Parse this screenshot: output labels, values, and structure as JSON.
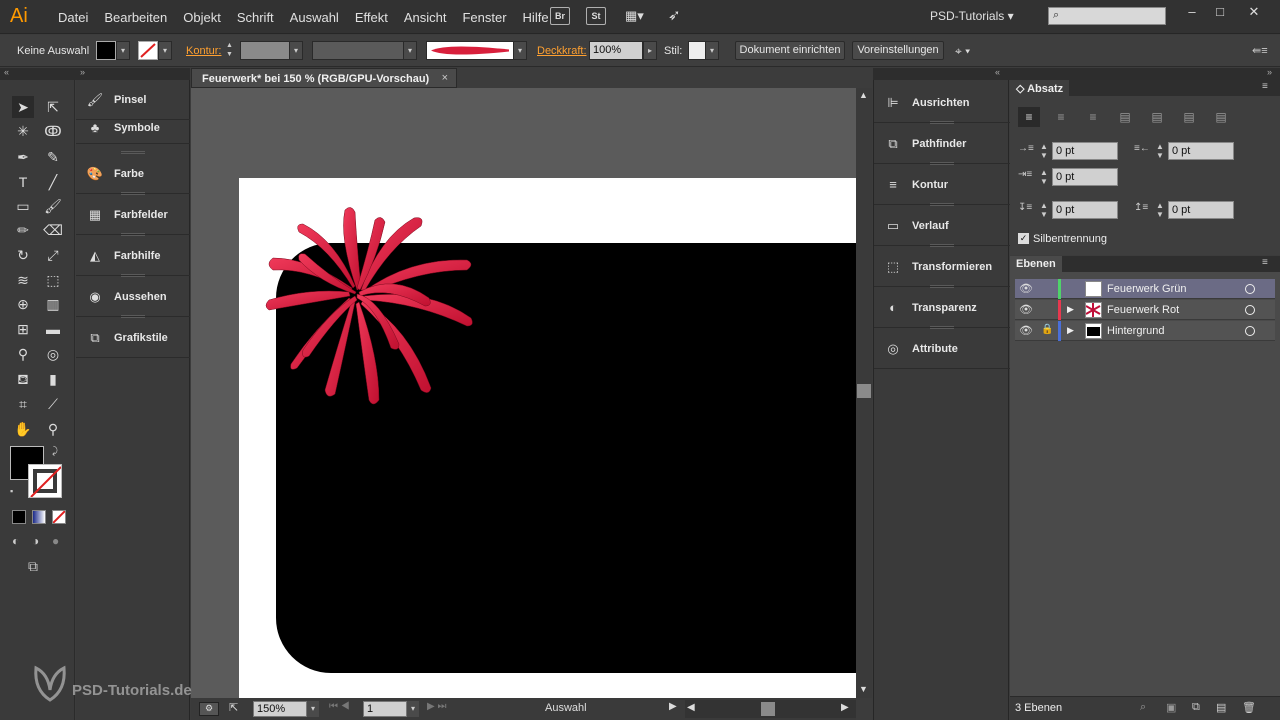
{
  "app": {
    "logo": "Ai",
    "workspace": "PSD-Tutorials",
    "search_placeholder": ""
  },
  "menu": [
    "Datei",
    "Bearbeiten",
    "Objekt",
    "Schrift",
    "Auswahl",
    "Effekt",
    "Ansicht",
    "Fenster",
    "Hilfe"
  ],
  "bridge_buttons": [
    "Br",
    "St"
  ],
  "control_bar": {
    "selection": "Keine Auswahl",
    "kontur_label": "Kontur:",
    "deckkraft_label": "Deckkraft:",
    "deckkraft_value": "100%",
    "stil_label": "Stil:",
    "doc_setup": "Dokument einrichten",
    "prefs": "Voreinstellungen"
  },
  "document": {
    "tab_title": "Feuerwerk* bei 150 % (RGB/GPU-Vorschau)",
    "close": "×"
  },
  "left_panels": [
    "Pinsel",
    "Symbole",
    "Farbe",
    "Farbfelder",
    "Farbhilfe",
    "Aussehen",
    "Grafikstile"
  ],
  "right_panels": [
    "Ausrichten",
    "Pathfinder",
    "Kontur",
    "Verlauf",
    "Transformieren",
    "Transparenz",
    "Attribute"
  ],
  "absatz": {
    "tab": "Absatz",
    "fields": {
      "left_indent": "0 pt",
      "right_indent": "0 pt",
      "first_line": "0 pt",
      "space_before": "0 pt",
      "space_after": "0 pt"
    },
    "hyphenation": "Silbentrennung"
  },
  "ebenen": {
    "tab": "Ebenen",
    "layers": [
      {
        "name": "Feuerwerk Grün",
        "color": "#4fd36a",
        "selected": true,
        "locked": false
      },
      {
        "name": "Feuerwerk Rot",
        "color": "#e8384f",
        "selected": false,
        "locked": false
      },
      {
        "name": "Hintergrund",
        "color": "#4a6fd8",
        "selected": false,
        "locked": true
      }
    ],
    "count": "3 Ebenen"
  },
  "status": {
    "zoom": "150%",
    "page": "1",
    "tool": "Auswahl"
  },
  "watermark": "PSD-Tutorials.de",
  "colors": {
    "accent_orange": "#ff9a00",
    "firework_red": "#e8284f",
    "canvas_bg": "#5b5b5b"
  }
}
